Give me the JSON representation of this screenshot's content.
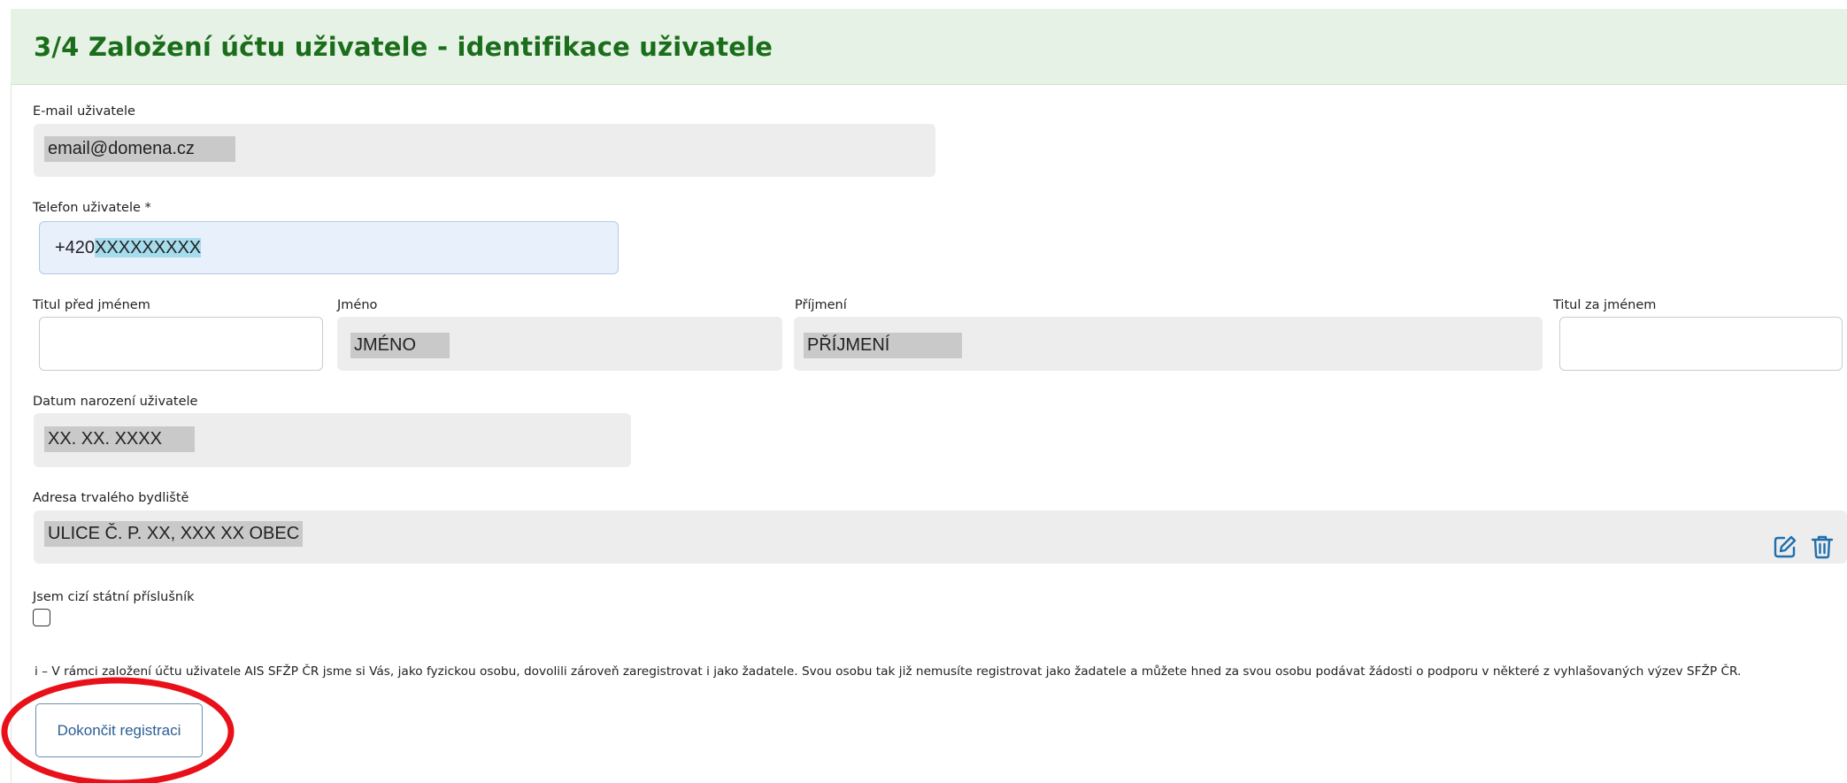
{
  "page_title": "3/4 Založení účtu uživatele - identifikace uživatele",
  "fields": {
    "email": {
      "label": "E-mail uživatele",
      "value": "email@domena.cz"
    },
    "phone": {
      "label": "Telefon uživatele *",
      "prefix": "+420",
      "value": "XXXXXXXXX"
    },
    "title_before": {
      "label": "Titul před jménem",
      "value": ""
    },
    "first_name": {
      "label": "Jméno",
      "value": "JMÉNO"
    },
    "last_name": {
      "label": "Příjmení",
      "value": "PŘÍJMENÍ"
    },
    "title_after": {
      "label": "Titul za jménem",
      "value": ""
    },
    "birth_date": {
      "label": "Datum narození uživatele",
      "value": "XX. XX. XXXX"
    },
    "address": {
      "label": "Adresa trvalého bydliště",
      "value": "ULICE Č. P. XX, XXX XX OBEC"
    },
    "foreigner": {
      "label": "Jsem cizí státní příslušník",
      "checked": false
    }
  },
  "info_text": "i – V rámci založení účtu uživatele AIS SFŽP ČR jsme si Vás, jako fyzickou osobu, dovolili zároveň zaregistrovat i jako žadatele. Svou osobu tak již nemusíte registrovat jako žadatele a můžete hned za svou osobu podávat žádosti o podporu v některé z vyhlašovaných výzev SFŽP ČR.",
  "submit_label": "Dokončit registraci",
  "icons": {
    "edit": "edit-icon",
    "delete": "trash-icon"
  },
  "colors": {
    "header_bg": "#e6f2e5",
    "title": "#1a6d1a",
    "accent": "#1f6fae",
    "annotation": "#e8111a"
  }
}
